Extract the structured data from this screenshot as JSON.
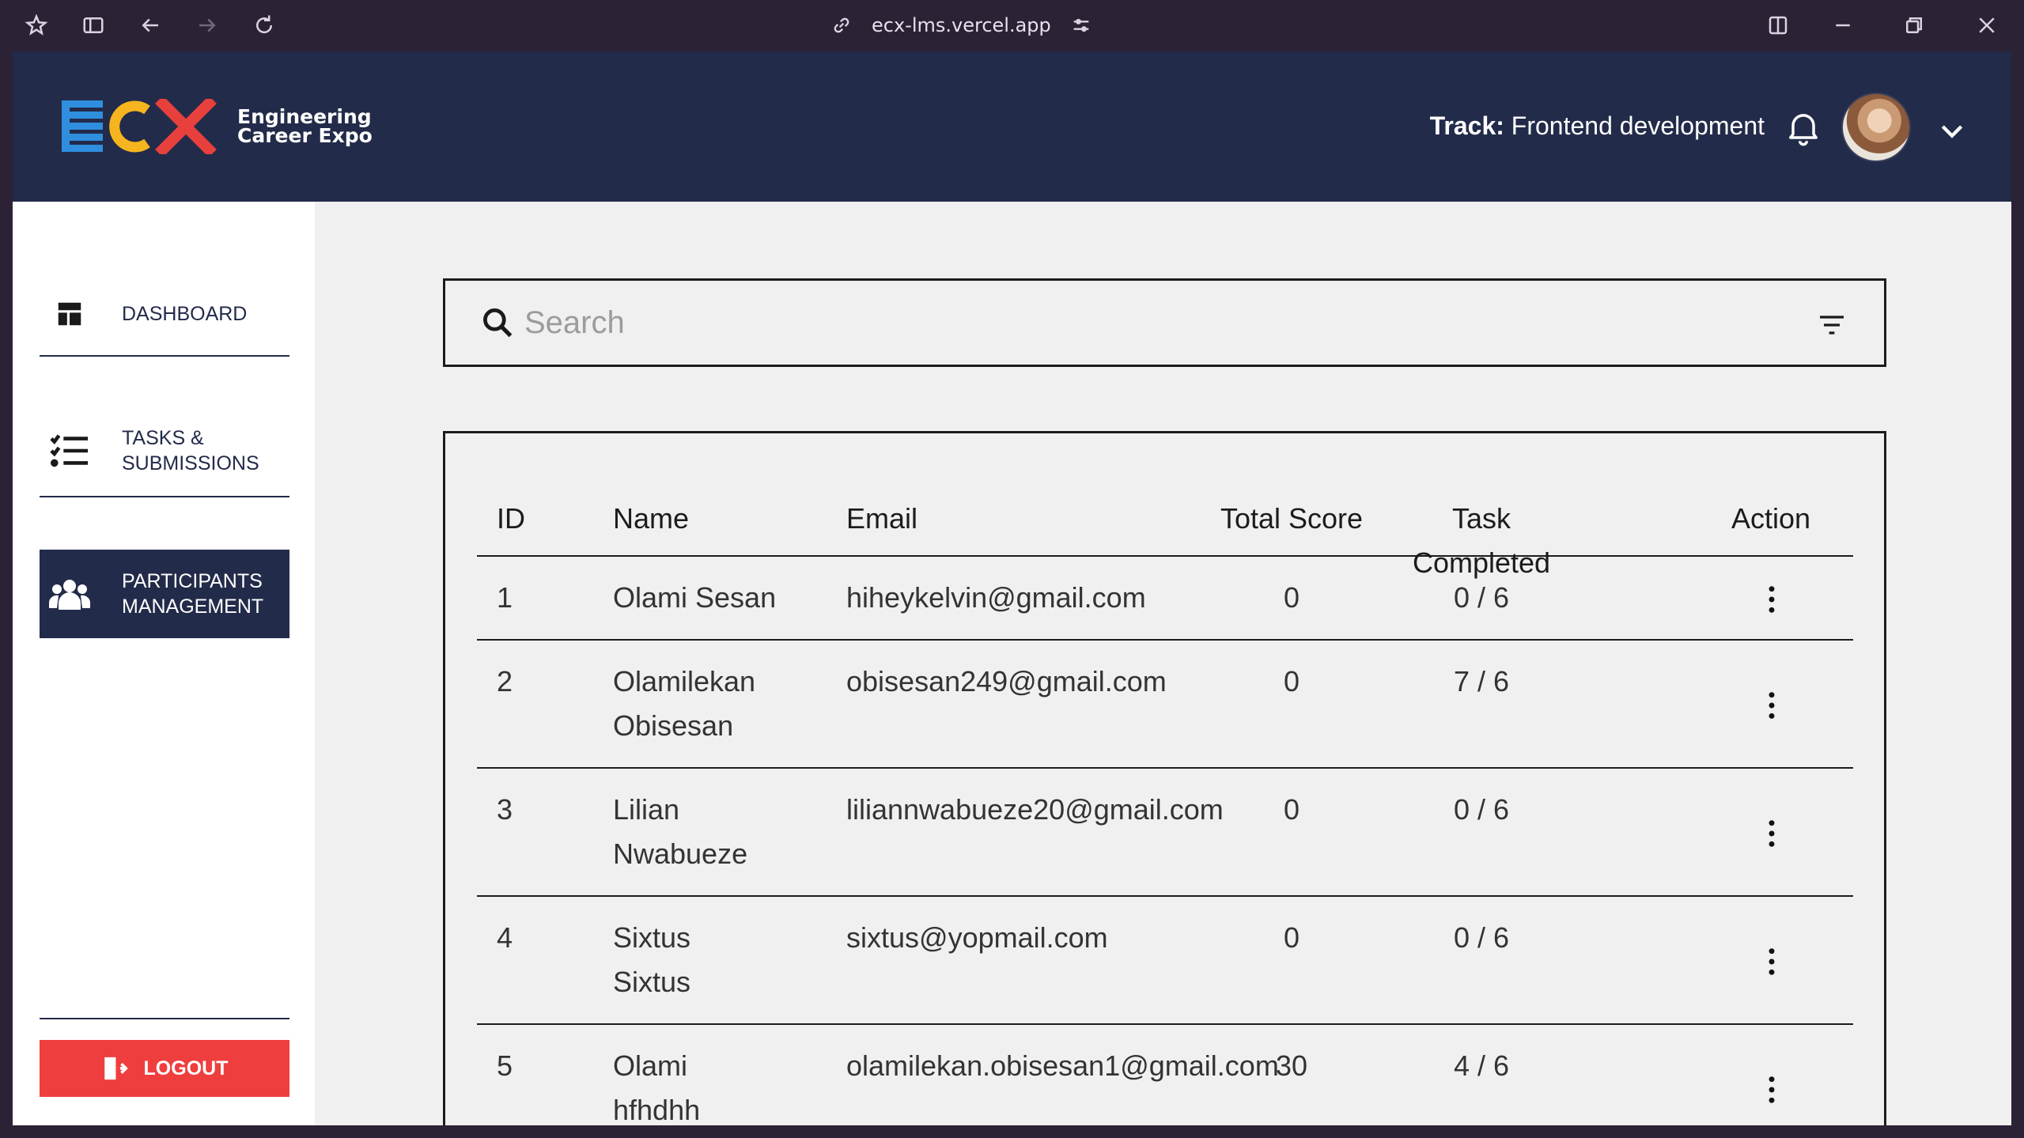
{
  "browser": {
    "url": "ecx-lms.vercel.app"
  },
  "brand": {
    "logo_mark": "ECX",
    "line1": "Engineering",
    "line2": "Career Expo"
  },
  "header": {
    "track_label": "Track:",
    "track_value": "Frontend development"
  },
  "sidebar": {
    "items": [
      {
        "label": "DASHBOARD",
        "icon": "dashboard-icon"
      },
      {
        "label_line1": "TASKS &",
        "label_line2": "SUBMISSIONS",
        "icon": "checklist-icon"
      },
      {
        "label_line1": "PARTICIPANTS",
        "label_line2": "MANAGEMENT",
        "icon": "users-icon",
        "active": true
      }
    ],
    "logout_label": "LOGOUT"
  },
  "search": {
    "placeholder": "Search"
  },
  "table": {
    "headers": {
      "id": "ID",
      "name": "Name",
      "email": "Email",
      "score": "Total Score",
      "task": "Task Completed",
      "action": "Action"
    },
    "rows": [
      {
        "id": "1",
        "name1": "Olami Sesan",
        "name2": "",
        "email": "hiheykelvin@gmail.com",
        "score": "0",
        "task": "0 / 6"
      },
      {
        "id": "2",
        "name1": "Olamilekan",
        "name2": "Obisesan",
        "email": "obisesan249@gmail.com",
        "score": "0",
        "task": "7 / 6"
      },
      {
        "id": "3",
        "name1": "Lilian",
        "name2": "Nwabueze",
        "email": "liliannwabueze20@gmail.com",
        "score": "0",
        "task": "0 / 6"
      },
      {
        "id": "4",
        "name1": "Sixtus",
        "name2": "Sixtus",
        "email": "sixtus@yopmail.com",
        "score": "0",
        "task": "0 / 6"
      },
      {
        "id": "5",
        "name1": "Olami",
        "name2": "hfhdhh",
        "email": "olamilekan.obisesan1@gmail.com",
        "score": "30",
        "task": "4 / 6"
      }
    ]
  },
  "colors": {
    "navy": "#232b4a",
    "logout_red": "#ef3e3e",
    "logo_blue": "#2f8fde",
    "logo_yellow": "#f6b51e",
    "logo_red": "#e8403c"
  }
}
